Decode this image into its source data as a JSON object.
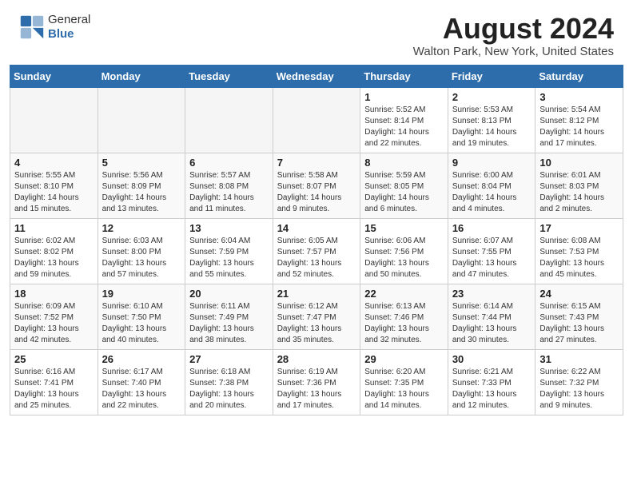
{
  "header": {
    "logo_general": "General",
    "logo_blue": "Blue",
    "month_year": "August 2024",
    "location": "Walton Park, New York, United States"
  },
  "weekdays": [
    "Sunday",
    "Monday",
    "Tuesday",
    "Wednesday",
    "Thursday",
    "Friday",
    "Saturday"
  ],
  "weeks": [
    [
      {
        "day": "",
        "info": ""
      },
      {
        "day": "",
        "info": ""
      },
      {
        "day": "",
        "info": ""
      },
      {
        "day": "",
        "info": ""
      },
      {
        "day": "1",
        "info": "Sunrise: 5:52 AM\nSunset: 8:14 PM\nDaylight: 14 hours\nand 22 minutes."
      },
      {
        "day": "2",
        "info": "Sunrise: 5:53 AM\nSunset: 8:13 PM\nDaylight: 14 hours\nand 19 minutes."
      },
      {
        "day": "3",
        "info": "Sunrise: 5:54 AM\nSunset: 8:12 PM\nDaylight: 14 hours\nand 17 minutes."
      }
    ],
    [
      {
        "day": "4",
        "info": "Sunrise: 5:55 AM\nSunset: 8:10 PM\nDaylight: 14 hours\nand 15 minutes."
      },
      {
        "day": "5",
        "info": "Sunrise: 5:56 AM\nSunset: 8:09 PM\nDaylight: 14 hours\nand 13 minutes."
      },
      {
        "day": "6",
        "info": "Sunrise: 5:57 AM\nSunset: 8:08 PM\nDaylight: 14 hours\nand 11 minutes."
      },
      {
        "day": "7",
        "info": "Sunrise: 5:58 AM\nSunset: 8:07 PM\nDaylight: 14 hours\nand 9 minutes."
      },
      {
        "day": "8",
        "info": "Sunrise: 5:59 AM\nSunset: 8:05 PM\nDaylight: 14 hours\nand 6 minutes."
      },
      {
        "day": "9",
        "info": "Sunrise: 6:00 AM\nSunset: 8:04 PM\nDaylight: 14 hours\nand 4 minutes."
      },
      {
        "day": "10",
        "info": "Sunrise: 6:01 AM\nSunset: 8:03 PM\nDaylight: 14 hours\nand 2 minutes."
      }
    ],
    [
      {
        "day": "11",
        "info": "Sunrise: 6:02 AM\nSunset: 8:02 PM\nDaylight: 13 hours\nand 59 minutes."
      },
      {
        "day": "12",
        "info": "Sunrise: 6:03 AM\nSunset: 8:00 PM\nDaylight: 13 hours\nand 57 minutes."
      },
      {
        "day": "13",
        "info": "Sunrise: 6:04 AM\nSunset: 7:59 PM\nDaylight: 13 hours\nand 55 minutes."
      },
      {
        "day": "14",
        "info": "Sunrise: 6:05 AM\nSunset: 7:57 PM\nDaylight: 13 hours\nand 52 minutes."
      },
      {
        "day": "15",
        "info": "Sunrise: 6:06 AM\nSunset: 7:56 PM\nDaylight: 13 hours\nand 50 minutes."
      },
      {
        "day": "16",
        "info": "Sunrise: 6:07 AM\nSunset: 7:55 PM\nDaylight: 13 hours\nand 47 minutes."
      },
      {
        "day": "17",
        "info": "Sunrise: 6:08 AM\nSunset: 7:53 PM\nDaylight: 13 hours\nand 45 minutes."
      }
    ],
    [
      {
        "day": "18",
        "info": "Sunrise: 6:09 AM\nSunset: 7:52 PM\nDaylight: 13 hours\nand 42 minutes."
      },
      {
        "day": "19",
        "info": "Sunrise: 6:10 AM\nSunset: 7:50 PM\nDaylight: 13 hours\nand 40 minutes."
      },
      {
        "day": "20",
        "info": "Sunrise: 6:11 AM\nSunset: 7:49 PM\nDaylight: 13 hours\nand 38 minutes."
      },
      {
        "day": "21",
        "info": "Sunrise: 6:12 AM\nSunset: 7:47 PM\nDaylight: 13 hours\nand 35 minutes."
      },
      {
        "day": "22",
        "info": "Sunrise: 6:13 AM\nSunset: 7:46 PM\nDaylight: 13 hours\nand 32 minutes."
      },
      {
        "day": "23",
        "info": "Sunrise: 6:14 AM\nSunset: 7:44 PM\nDaylight: 13 hours\nand 30 minutes."
      },
      {
        "day": "24",
        "info": "Sunrise: 6:15 AM\nSunset: 7:43 PM\nDaylight: 13 hours\nand 27 minutes."
      }
    ],
    [
      {
        "day": "25",
        "info": "Sunrise: 6:16 AM\nSunset: 7:41 PM\nDaylight: 13 hours\nand 25 minutes."
      },
      {
        "day": "26",
        "info": "Sunrise: 6:17 AM\nSunset: 7:40 PM\nDaylight: 13 hours\nand 22 minutes."
      },
      {
        "day": "27",
        "info": "Sunrise: 6:18 AM\nSunset: 7:38 PM\nDaylight: 13 hours\nand 20 minutes."
      },
      {
        "day": "28",
        "info": "Sunrise: 6:19 AM\nSunset: 7:36 PM\nDaylight: 13 hours\nand 17 minutes."
      },
      {
        "day": "29",
        "info": "Sunrise: 6:20 AM\nSunset: 7:35 PM\nDaylight: 13 hours\nand 14 minutes."
      },
      {
        "day": "30",
        "info": "Sunrise: 6:21 AM\nSunset: 7:33 PM\nDaylight: 13 hours\nand 12 minutes."
      },
      {
        "day": "31",
        "info": "Sunrise: 6:22 AM\nSunset: 7:32 PM\nDaylight: 13 hours\nand 9 minutes."
      }
    ]
  ]
}
